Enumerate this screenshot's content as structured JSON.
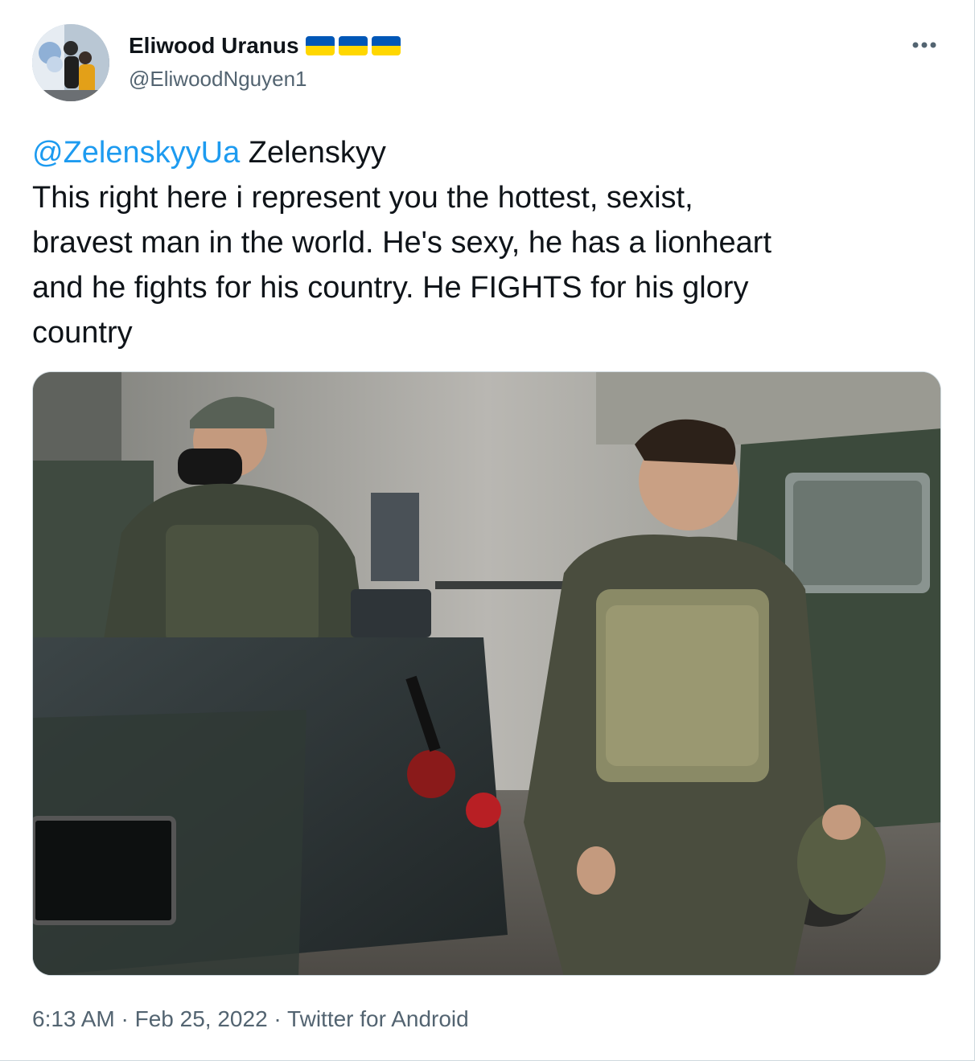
{
  "author": {
    "name": "Eliwood Uranus",
    "handle": "@EliwoodNguyen1",
    "name_flags": [
      "ukraine-flag",
      "ukraine-flag",
      "ukraine-flag"
    ]
  },
  "tweet": {
    "mention": "@ZelenskyyUa",
    "line1_rest": " Zelenskyy",
    "line2": "This right here i represent you the hottest, sexist,",
    "line3": "bravest man in the world. He's sexy, he has a lionheart",
    "line4": "and he fights for his country. He FIGHTS for his glory",
    "line5": "country"
  },
  "meta": {
    "time": "6:13 AM",
    "separator1": " · ",
    "date": "Feb 25, 2022",
    "separator2": " · ",
    "source": "Twitter for Android"
  },
  "icons": {
    "more": "more-horizontal-icon"
  },
  "colors": {
    "link": "#1d9bf0",
    "secondary_text": "#536471",
    "flag_blue": "#0057b7",
    "flag_yellow": "#ffd700"
  }
}
